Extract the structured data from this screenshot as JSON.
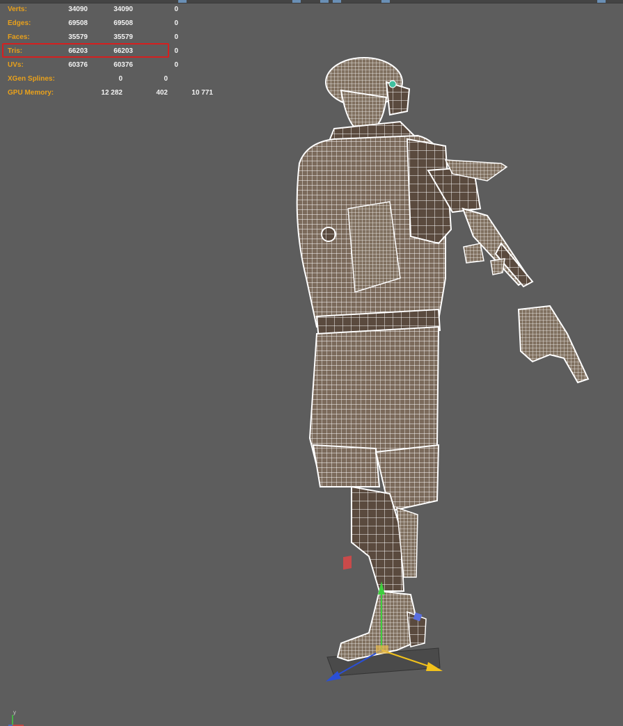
{
  "hud": {
    "rows": [
      {
        "label": "Verts:",
        "c1": "34090",
        "c2": "34090",
        "c3": "0"
      },
      {
        "label": "Edges:",
        "c1": "69508",
        "c2": "69508",
        "c3": "0"
      },
      {
        "label": "Faces:",
        "c1": "35579",
        "c2": "35579",
        "c3": "0"
      },
      {
        "label": "Tris:",
        "c1": "66203",
        "c2": "66203",
        "c3": "0"
      },
      {
        "label": "UVs:",
        "c1": "60376",
        "c2": "60376",
        "c3": "0"
      },
      {
        "label": "XGen Splines:",
        "c1": "",
        "c2": "0",
        "c3": "0"
      }
    ],
    "gpu": {
      "label": "GPU Memory:",
      "c1": "12 282",
      "c2": "402",
      "c3": "10 771"
    },
    "highlighted_row": "Tris:"
  },
  "axis": {
    "y_label": "y",
    "x_color": "#e0403a",
    "y_color": "#3fcf3f",
    "z_color": "#3f6fe0"
  },
  "colors": {
    "label_orange": "#e9a11b",
    "value_white": "#f2f2f2",
    "highlight_red": "#d61f1f",
    "viewport_bg": "#5d5d5d",
    "mesh_fill": "#7a6a5c",
    "wire": "#ffffff"
  },
  "gizmo": {
    "move_icon": "move-manipulator-icon"
  }
}
